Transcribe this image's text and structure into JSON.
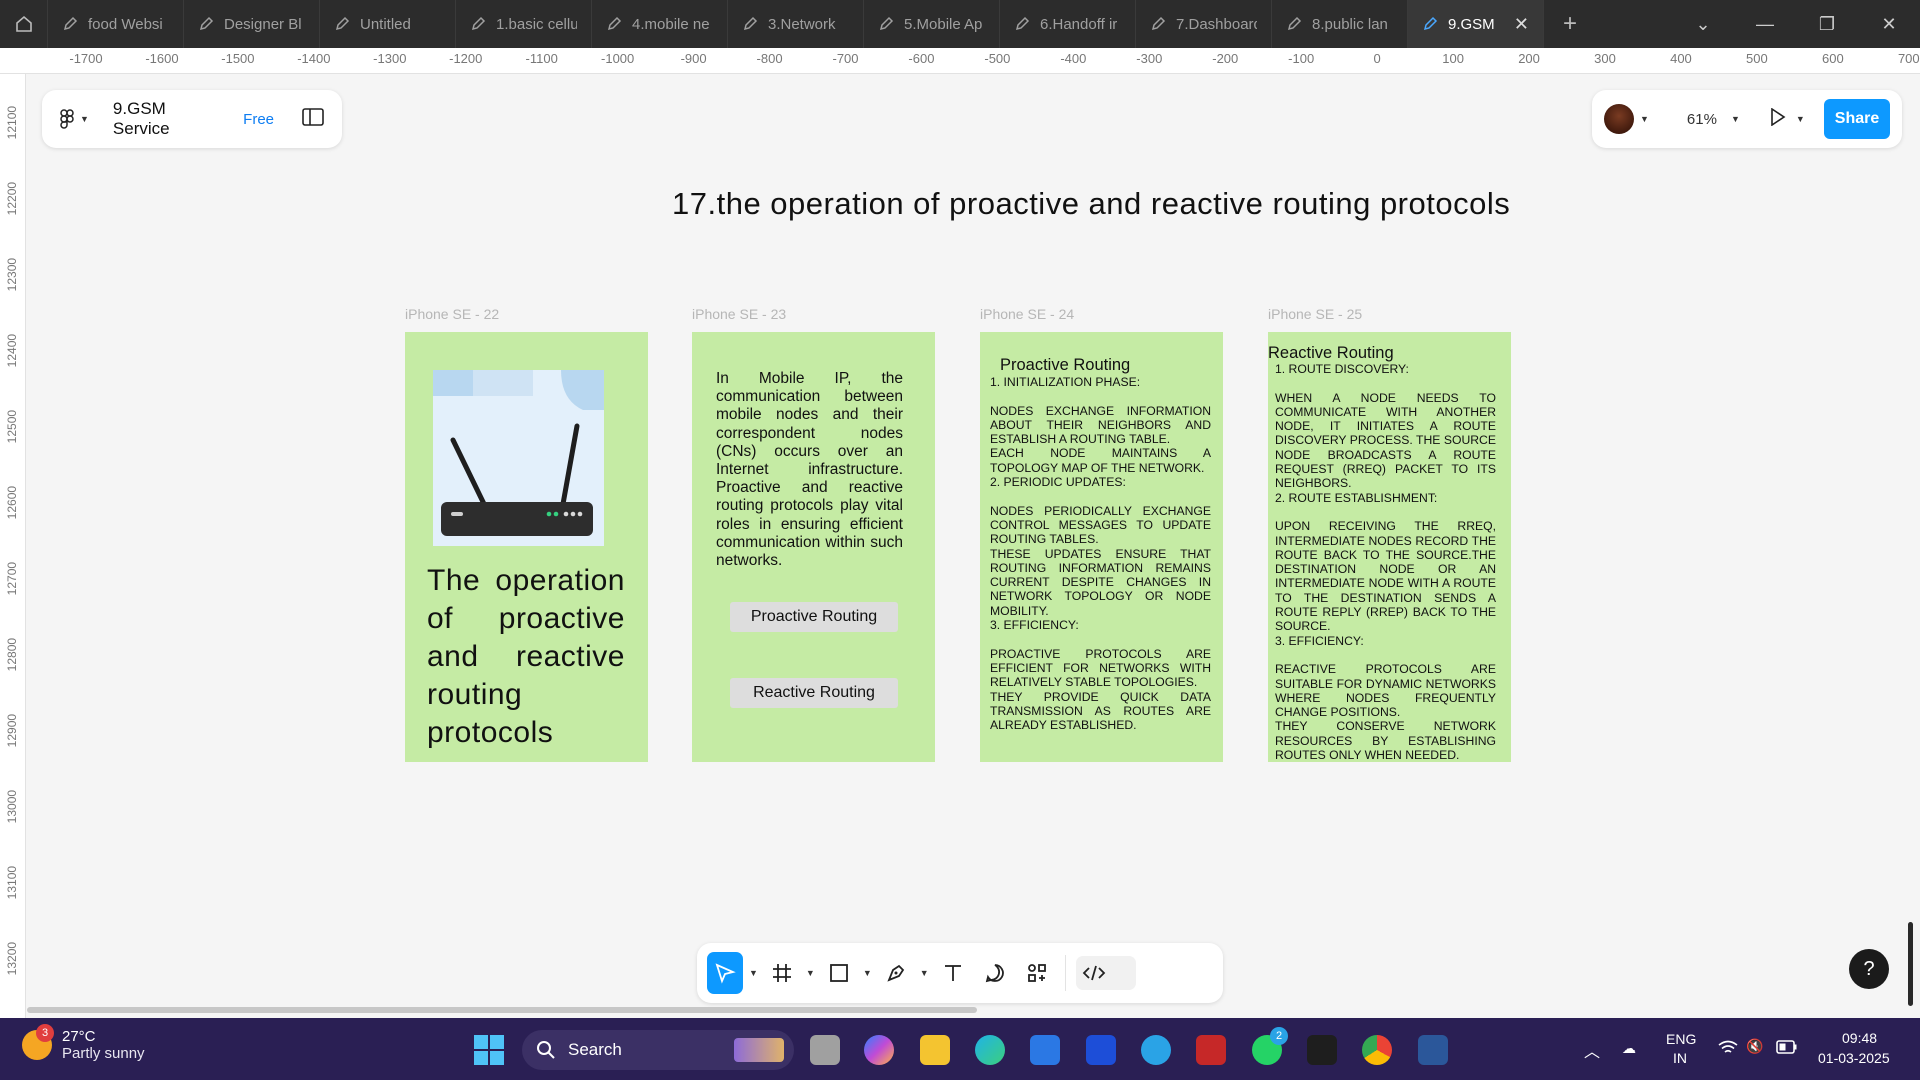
{
  "tabs": [
    {
      "label": "food Websi"
    },
    {
      "label": "Designer Bl"
    },
    {
      "label": "Untitled"
    },
    {
      "label": "1.basic cellu"
    },
    {
      "label": "4.mobile ne"
    },
    {
      "label": "3.Network"
    },
    {
      "label": "5.Mobile Ap"
    },
    {
      "label": "6.Handoff ir"
    },
    {
      "label": "7.Dashboard"
    },
    {
      "label": "8.public lan"
    },
    {
      "label": "9.GSM"
    }
  ],
  "ruler_top": [
    "-1700",
    "-1600",
    "-1500",
    "-1400",
    "-1300",
    "-1200",
    "-1100",
    "-1000",
    "-900",
    "-800",
    "-700",
    "-600",
    "-500",
    "-400",
    "-300",
    "-200",
    "-100",
    "0",
    "100",
    "200",
    "300",
    "400",
    "500",
    "600",
    "700"
  ],
  "ruler_left": [
    "12100",
    "12200",
    "12300",
    "12400",
    "12500",
    "12600",
    "12700",
    "12800",
    "12900",
    "13000",
    "13100",
    "13200"
  ],
  "file": {
    "name": "9.GSM Service",
    "plan": "Free"
  },
  "zoom": "61%",
  "share_label": "Share",
  "page_heading": "17.the operation of proactive and reactive routing protocols",
  "frames": {
    "f22": {
      "label": "iPhone SE - 22",
      "title": "The operation of proactive and reactive routing protocols"
    },
    "f23": {
      "label": "iPhone SE - 23",
      "intro": "In Mobile IP, the communication between mobile nodes and their correspondent nodes (CNs) occurs over an Internet infrastructure. Proactive and reactive routing protocols play vital roles in ensuring efficient communication within such networks.",
      "btn_proactive": "Proactive Routing",
      "btn_reactive": "Reactive Routing"
    },
    "f24": {
      "label": "iPhone SE - 24",
      "title": "Proactive Routing",
      "lines": [
        "1. INITIALIZATION PHASE:",
        "",
        "NODES EXCHANGE INFORMATION ABOUT THEIR NEIGHBORS AND ESTABLISH A ROUTING TABLE.",
        "EACH NODE MAINTAINS A TOPOLOGY MAP OF THE NETWORK.",
        "2. PERIODIC UPDATES:",
        "",
        "NODES PERIODICALLY EXCHANGE CONTROL MESSAGES TO UPDATE ROUTING TABLES.",
        "THESE UPDATES ENSURE THAT ROUTING INFORMATION REMAINS CURRENT DESPITE CHANGES IN NETWORK TOPOLOGY OR NODE MOBILITY.",
        "3. EFFICIENCY:",
        "",
        "PROACTIVE PROTOCOLS ARE EFFICIENT FOR NETWORKS WITH RELATIVELY STABLE TOPOLOGIES.",
        "THEY PROVIDE QUICK DATA TRANSMISSION AS ROUTES ARE ALREADY ESTABLISHED."
      ]
    },
    "f25": {
      "label": "iPhone SE - 25",
      "title": "Reactive Routing",
      "lines": [
        "1. ROUTE DISCOVERY:",
        "",
        "WHEN A NODE NEEDS TO COMMUNICATE WITH ANOTHER NODE, IT INITIATES A ROUTE DISCOVERY PROCESS. THE SOURCE NODE BROADCASTS A ROUTE REQUEST (RREQ) PACKET TO ITS NEIGHBORS.",
        "2. ROUTE ESTABLISHMENT:",
        "",
        "UPON RECEIVING THE RREQ, INTERMEDIATE NODES RECORD THE ROUTE BACK TO THE SOURCE.THE DESTINATION NODE OR AN INTERMEDIATE NODE WITH A ROUTE TO THE DESTINATION SENDS A ROUTE REPLY (RREP) BACK TO THE SOURCE.",
        "3. EFFICIENCY:",
        "",
        "REACTIVE PROTOCOLS ARE SUITABLE FOR DYNAMIC NETWORKS WHERE NODES FREQUENTLY CHANGE POSITIONS.",
        "THEY CONSERVE NETWORK RESOURCES BY ESTABLISHING ROUTES ONLY WHEN NEEDED."
      ]
    }
  },
  "taskbar": {
    "weather_temp": "27°C",
    "weather_desc": "Partly sunny",
    "weather_badge": "3",
    "search_label": "Search",
    "whatsapp_badge": "2",
    "lang_top": "ENG",
    "lang_bottom": "IN",
    "time": "09:48",
    "date": "01-03-2025"
  },
  "colors": {
    "frame_bg": "#c5eba4",
    "accent": "#0d99ff",
    "taskbar": "#2a1f54"
  }
}
